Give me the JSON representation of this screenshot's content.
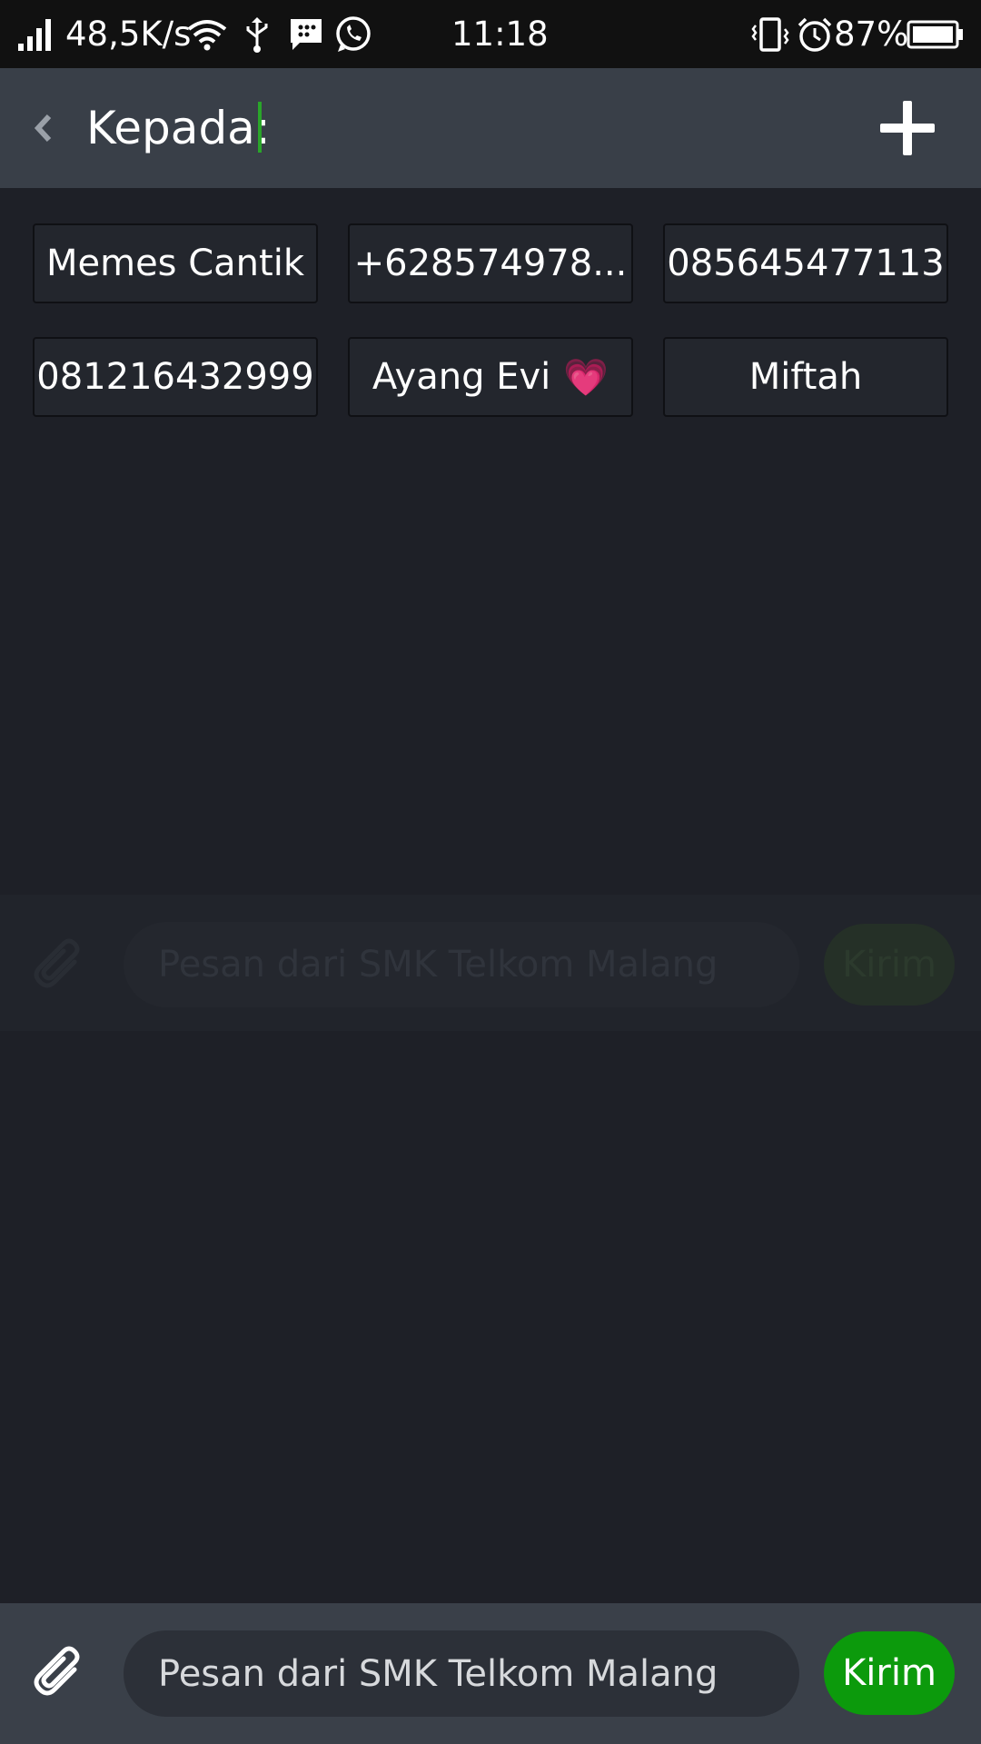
{
  "status_bar": {
    "network_speed": "48,5K/s",
    "time": "11:18",
    "battery_percent": "87%",
    "icons": [
      "signal-icon",
      "wifi-icon",
      "usb-icon",
      "bbm-icon",
      "whatsapp-icon",
      "vibrate-icon",
      "alarm-icon",
      "battery-icon"
    ]
  },
  "header": {
    "to_label": "Kepada:",
    "back_icon": "chevron-left-icon",
    "add_icon": "plus-icon"
  },
  "recipients": [
    {
      "label": "Memes Cantik"
    },
    {
      "label": "+628574978..."
    },
    {
      "label": "085645477113"
    },
    {
      "label": "081216432999"
    },
    {
      "label": "Ayang Evi",
      "emoji": "💗"
    },
    {
      "label": "Miftah"
    }
  ],
  "composer": {
    "message": "Pesan dari SMK Telkom Malang",
    "send_label": "Kirim",
    "attach_icon": "paperclip-icon"
  },
  "colors": {
    "background": "#1e2027",
    "header": "#393f48",
    "status_bar": "#111111",
    "accent_green": "#0c9a0c"
  }
}
